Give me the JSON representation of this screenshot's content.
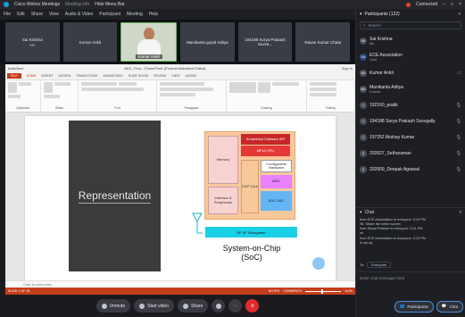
{
  "window": {
    "app_title": "Cisco Webex Meetings",
    "meeting_info_label": "Meeting info",
    "hide_menu_bar_label": "Hide Menu Bar",
    "connection_status": "Connected",
    "window_controls": [
      "–",
      "□",
      "×"
    ]
  },
  "menu": [
    "File",
    "Edit",
    "Share",
    "View",
    "Audio & Video",
    "Participant",
    "Meeting",
    "Help"
  ],
  "video_strip": [
    {
      "name": "Sai Krishna",
      "sub": "Me"
    },
    {
      "name": "Kumar Ankit",
      "sub": ""
    },
    {
      "name": "Kumar Ankit",
      "video": true
    },
    {
      "name": "Manikanta gopal Aditya",
      "sub": ""
    },
    {
      "name": "194188 Surya Prakash Suvva...",
      "sub": ""
    },
    {
      "name": "Ravan Kumar Chala",
      "sub": ""
    }
  ],
  "ppt": {
    "title_left": "AutoSave",
    "title_center": "ADC_Flow - PowerPoint (Product Activation Failed)",
    "sign_in": "Sign in",
    "tabs": [
      "FILE",
      "HOME",
      "INSERT",
      "DESIGN",
      "TRANSITIONS",
      "ANIMATIONS",
      "SLIDE SHOW",
      "REVIEW",
      "VIEW",
      "ADOBE"
    ],
    "ribbon_groups": [
      "Clipboard",
      "Slides",
      "Font",
      "Paragraph",
      "Drawing",
      "Editing"
    ],
    "notes_placeholder": "Click to add notes",
    "status_slide": "SLIDE 1 OF 35",
    "status_notes": "NOTES",
    "status_comments": "COMMENTS",
    "status_zoom": "110%"
  },
  "slide": {
    "left_title": "Representation",
    "blocks": {
      "memory": "Memory",
      "interface": "Interface & Peripherals",
      "embedded_sw": "Embedded Software API",
      "mpu": "MPU/ CPU",
      "configurable": "Configurable Hardware",
      "dsp": "DSP Core",
      "asic": "ASIC",
      "adc_dac": "ADC DAC"
    },
    "rf": "RF I/F Subsystem",
    "soc_title_1": "System-on-Chip",
    "soc_title_2": "(SoC)"
  },
  "controls": {
    "unmute": "Unmute",
    "start_video": "Start video",
    "share": "Share",
    "end": "×"
  },
  "participants": {
    "header": "Participants (122)",
    "search_placeholder": "Search",
    "list": [
      {
        "initials": "SK",
        "name": "Sai Krishna",
        "sub": "Me"
      },
      {
        "initials": "EA",
        "name": "ECE Association",
        "sub": "Host"
      },
      {
        "initials": "KA",
        "name": "Kumar Ankit",
        "sub": ""
      },
      {
        "initials": "MA",
        "name": "Manikanta Aditya",
        "sub": "Cohost"
      },
      {
        "initials": "1",
        "name": "192160_pratik",
        "sub": ""
      },
      {
        "initials": "1",
        "name": "194188 Surya Prakash Suvvgally",
        "sub": ""
      },
      {
        "initials": "1",
        "name": "197252 Akshay Kumar",
        "sub": ""
      },
      {
        "initials": "2",
        "name": "202627_Sethuraman",
        "sub": ""
      },
      {
        "initials": "2",
        "name": "202609_Deepak Agrawal",
        "sub": ""
      }
    ]
  },
  "chat": {
    "header": "Chat",
    "messages": [
      "from ECE Association to everyone: 3:10 PM",
      "Sir, Share the entire screen",
      "from Surya Prakash to everyone: 3:11 PM",
      "ok",
      "from ECE Association to everyone: 3:12 PM",
      "hi sai raj"
    ],
    "to_label": "To:",
    "to_value": "Everyone",
    "input_placeholder": "Enter chat message here"
  },
  "panel_footer": {
    "participants_btn": "Participants",
    "chat_btn": "Chat"
  },
  "colors": {
    "ppt_accent": "#c43e1c",
    "end_button": "#e02c2c",
    "rf_block": "#19d0e6"
  }
}
